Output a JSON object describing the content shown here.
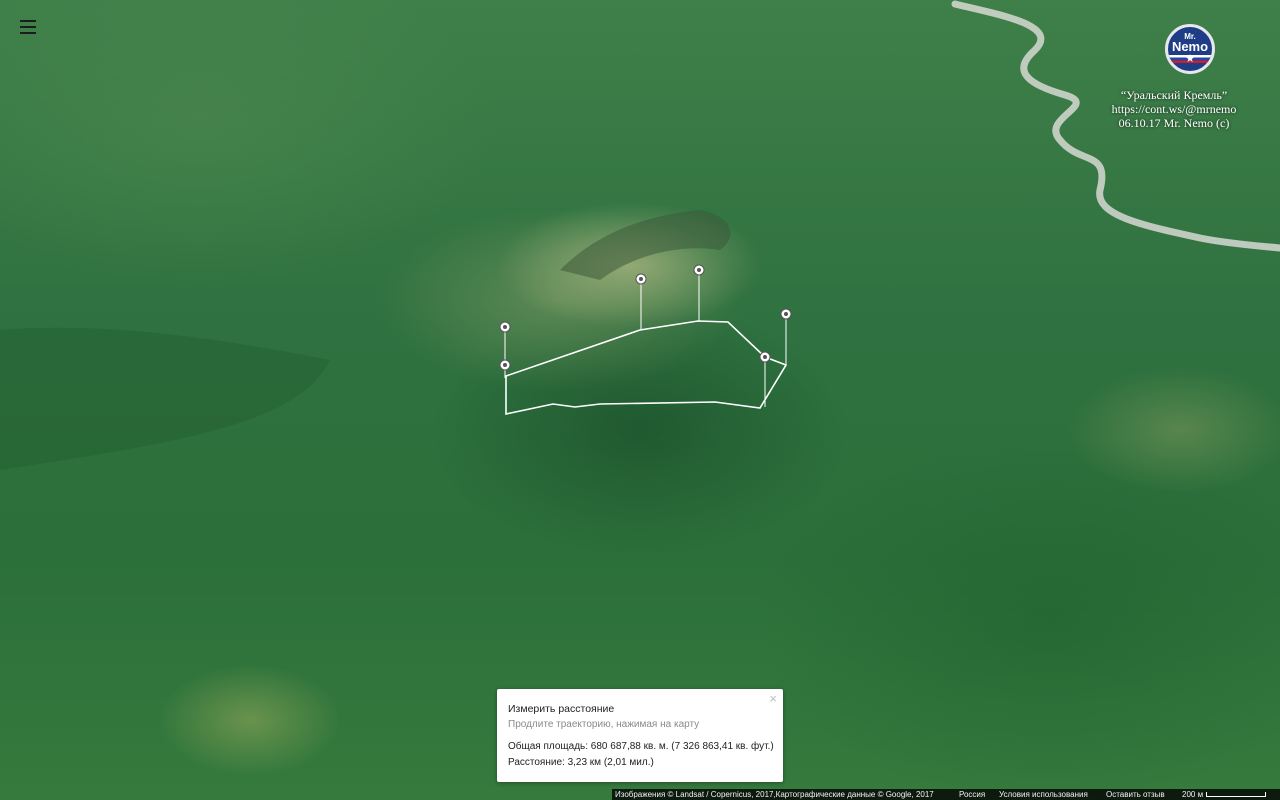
{
  "map": {
    "measure_points": [
      {
        "id": "p1"
      },
      {
        "id": "p2"
      },
      {
        "id": "p3"
      },
      {
        "id": "p4"
      },
      {
        "id": "p5"
      },
      {
        "id": "p6"
      }
    ]
  },
  "menu": {
    "icon": "hamburger-menu-icon"
  },
  "badge": {
    "line1": "Mr.",
    "line2": "Nemo",
    "star": "★"
  },
  "watermark": {
    "title": "“Уральский Кремль”",
    "url": "https://cont.ws/@mrnemo",
    "date_credit": "06.10.17  Mr. Nemo (c)"
  },
  "measure_panel": {
    "title": "Измерить расстояние",
    "hint": "Продлите траекторию, нажимая на карту",
    "area": "Общая площадь: 680 687,88 кв. м. (7 326 863,41 кв. фут.)",
    "distance": "Расстояние: 3,23 км (2,01 мил.)",
    "close": "×"
  },
  "footer": {
    "imagery": "Изображения © Landsat / Copernicus, 2017,Картографические данные © Google, 2017",
    "region": "Россия",
    "terms": "Условия использования",
    "feedback": "Оставить отзыв",
    "scale": "200 м"
  }
}
